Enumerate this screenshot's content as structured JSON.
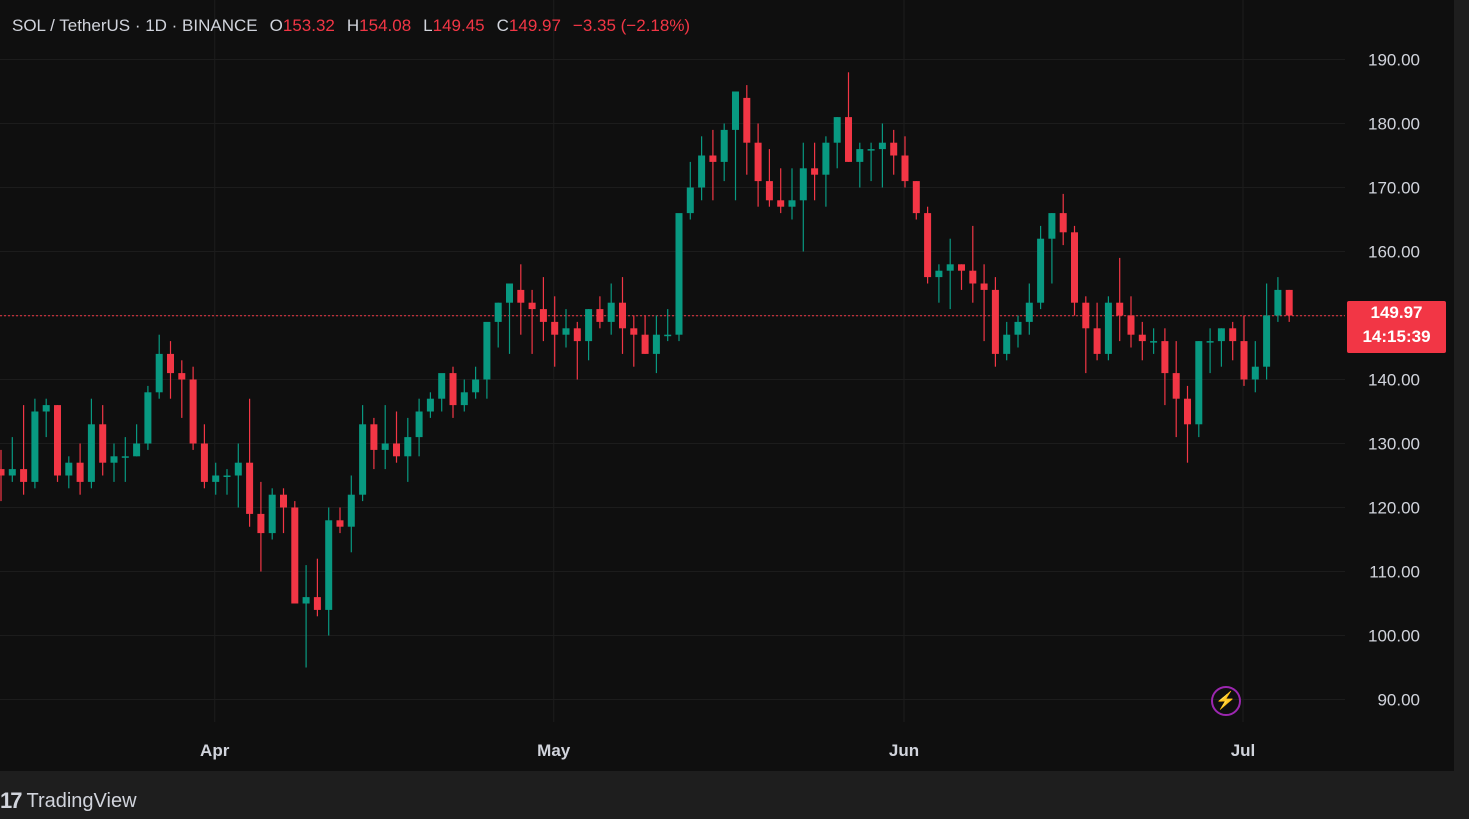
{
  "header": {
    "symbol": "SOL / TetherUS · 1D · BINANCE",
    "open_label": "O",
    "open": "153.32",
    "high_label": "H",
    "high": "154.08",
    "low_label": "L",
    "low": "149.45",
    "close_label": "C",
    "close": "149.97",
    "change": "−3.35 (−2.18%)"
  },
  "price_tag": {
    "price": "149.97",
    "countdown": "14:15:39"
  },
  "branding": {
    "logo_mark": "17",
    "name": "TradingView"
  },
  "icons": {
    "lightning": "lightning-icon"
  },
  "colors": {
    "up": "#089981",
    "down": "#f23645",
    "background": "#0f0f0f",
    "grid": "#1c1c1c",
    "text": "#d1d4dc"
  },
  "chart_data": {
    "type": "candlestick",
    "title": "SOL / TetherUS · 1D · BINANCE",
    "ylim": [
      85,
      198
    ],
    "y_ticks": [
      "190.00",
      "180.00",
      "170.00",
      "160.00",
      "150.00",
      "140.00",
      "130.00",
      "120.00",
      "110.00",
      "100.00",
      "90.00"
    ],
    "x_ticks": [
      {
        "label": "Apr",
        "index": 19
      },
      {
        "label": "May",
        "index": 49
      },
      {
        "label": "Jun",
        "index": 80
      },
      {
        "label": "Jul",
        "index": 110
      }
    ],
    "last_price": 149.97,
    "candles": [
      [
        126,
        129,
        121,
        125
      ],
      [
        125,
        131,
        124,
        126
      ],
      [
        126,
        136,
        122,
        124
      ],
      [
        124,
        137,
        123,
        135
      ],
      [
        135,
        137,
        131,
        136
      ],
      [
        136,
        136,
        124,
        125
      ],
      [
        125,
        128,
        123,
        127
      ],
      [
        127,
        130,
        122,
        124
      ],
      [
        124,
        137,
        123,
        133
      ],
      [
        133,
        136,
        125,
        127
      ],
      [
        127,
        130,
        124,
        128
      ],
      [
        128,
        131,
        124,
        128
      ],
      [
        128,
        133,
        128,
        130
      ],
      [
        130,
        139,
        129,
        138
      ],
      [
        138,
        147,
        137,
        144
      ],
      [
        144,
        146,
        137,
        141
      ],
      [
        141,
        143,
        134,
        140
      ],
      [
        140,
        142,
        129,
        130
      ],
      [
        130,
        133,
        123,
        124
      ],
      [
        124,
        127,
        122,
        125
      ],
      [
        125,
        126,
        122,
        125
      ],
      [
        125,
        130,
        120,
        127
      ],
      [
        127,
        137,
        117,
        119
      ],
      [
        119,
        124,
        110,
        116
      ],
      [
        116,
        123,
        115,
        122
      ],
      [
        122,
        123,
        116,
        120
      ],
      [
        120,
        121,
        107,
        105
      ],
      [
        105,
        111,
        95,
        106
      ],
      [
        106,
        112,
        103,
        104
      ],
      [
        104,
        120,
        100,
        118
      ],
      [
        118,
        120,
        116,
        117
      ],
      [
        117,
        125,
        113,
        122
      ],
      [
        122,
        136,
        121,
        133
      ],
      [
        133,
        134,
        126,
        129
      ],
      [
        129,
        136,
        126,
        130
      ],
      [
        130,
        135,
        127,
        128
      ],
      [
        128,
        134,
        124,
        131
      ],
      [
        131,
        137,
        128,
        135
      ],
      [
        135,
        138,
        134,
        137
      ],
      [
        137,
        140,
        135,
        141
      ],
      [
        141,
        142,
        134,
        136
      ],
      [
        136,
        140,
        135,
        138
      ],
      [
        138,
        142,
        137,
        140
      ],
      [
        140,
        145,
        137,
        149
      ],
      [
        149,
        152,
        145,
        152
      ],
      [
        152,
        154,
        144,
        155
      ],
      [
        154,
        158,
        147,
        152
      ],
      [
        152,
        154,
        144,
        151
      ],
      [
        151,
        156,
        146,
        149
      ],
      [
        149,
        153,
        142,
        147
      ],
      [
        147,
        151,
        145,
        148
      ],
      [
        148,
        149,
        140,
        146
      ],
      [
        146,
        151,
        143,
        151
      ],
      [
        151,
        153,
        148,
        149
      ],
      [
        149,
        155,
        147,
        152
      ],
      [
        152,
        156,
        144,
        148
      ],
      [
        148,
        150,
        142,
        147
      ],
      [
        147,
        150,
        144,
        144
      ],
      [
        144,
        150,
        141,
        147
      ],
      [
        147,
        151,
        146,
        147
      ],
      [
        147,
        158,
        146,
        166
      ],
      [
        166,
        174,
        165,
        170
      ],
      [
        170,
        178,
        168,
        175
      ],
      [
        175,
        179,
        168,
        174
      ],
      [
        174,
        180,
        171,
        179
      ],
      [
        179,
        185,
        168,
        185
      ],
      [
        184,
        186,
        172,
        177
      ],
      [
        177,
        180,
        167,
        171
      ],
      [
        171,
        176,
        167,
        168
      ],
      [
        168,
        173,
        166,
        167
      ],
      [
        167,
        173,
        165,
        168
      ],
      [
        168,
        177,
        160,
        173
      ],
      [
        173,
        177,
        168,
        172
      ],
      [
        172,
        178,
        167,
        177
      ],
      [
        177,
        181,
        173,
        181
      ],
      [
        181,
        188,
        174,
        174
      ],
      [
        174,
        177,
        170,
        176
      ],
      [
        176,
        177,
        171,
        176
      ],
      [
        176,
        180,
        170,
        177
      ],
      [
        177,
        179,
        172,
        175
      ],
      [
        175,
        178,
        170,
        171
      ],
      [
        171,
        171,
        165,
        166
      ],
      [
        166,
        167,
        155,
        156
      ],
      [
        156,
        158,
        152,
        157
      ],
      [
        157,
        162,
        151,
        158
      ],
      [
        158,
        158,
        154,
        157
      ],
      [
        157,
        164,
        152,
        155
      ],
      [
        155,
        158,
        146,
        154
      ],
      [
        154,
        156,
        142,
        144
      ],
      [
        144,
        149,
        143,
        147
      ],
      [
        147,
        150,
        145,
        149
      ],
      [
        149,
        155,
        147,
        152
      ],
      [
        152,
        164,
        151,
        162
      ],
      [
        162,
        166,
        155,
        166
      ],
      [
        166,
        169,
        161,
        163
      ],
      [
        163,
        164,
        150,
        152
      ],
      [
        152,
        153,
        141,
        148
      ],
      [
        148,
        152,
        143,
        144
      ],
      [
        144,
        153,
        143,
        152
      ],
      [
        152,
        159,
        146,
        150
      ],
      [
        150,
        153,
        145,
        147
      ],
      [
        147,
        149,
        143,
        146
      ],
      [
        146,
        148,
        144,
        146
      ],
      [
        146,
        148,
        136,
        141
      ],
      [
        141,
        146,
        131,
        137
      ],
      [
        137,
        139,
        127,
        133
      ],
      [
        133,
        146,
        131,
        146
      ],
      [
        146,
        148,
        141,
        146
      ],
      [
        146,
        148,
        142,
        148
      ],
      [
        148,
        149,
        143,
        146
      ],
      [
        146,
        150,
        139,
        140
      ],
      [
        140,
        146,
        138,
        142
      ],
      [
        142,
        155,
        140,
        150
      ],
      [
        150,
        156,
        149,
        154
      ],
      [
        154,
        154,
        149,
        150
      ]
    ]
  }
}
